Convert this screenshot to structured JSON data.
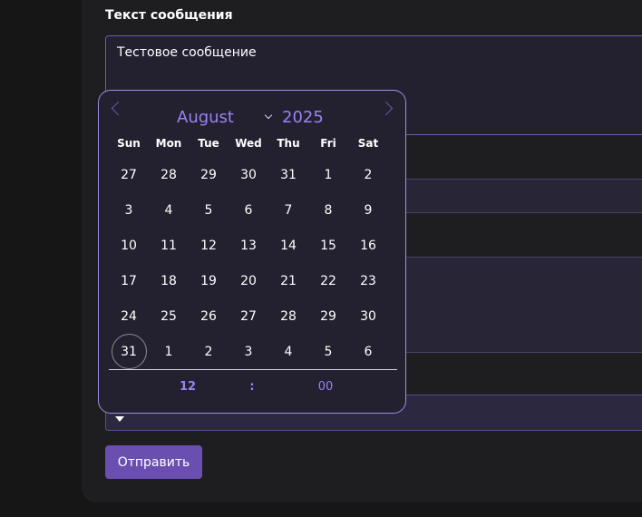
{
  "form": {
    "section_title": "Текст сообщения",
    "message_value": "Тестовое сообщение",
    "submit_label": "Отправить"
  },
  "datepicker": {
    "month": "August",
    "year": "2025",
    "weekdays": [
      "Sun",
      "Mon",
      "Tue",
      "Wed",
      "Thu",
      "Fri",
      "Sat"
    ],
    "days": [
      "27",
      "28",
      "29",
      "30",
      "31",
      "1",
      "2",
      "3",
      "4",
      "5",
      "6",
      "7",
      "8",
      "9",
      "10",
      "11",
      "12",
      "13",
      "14",
      "15",
      "16",
      "17",
      "18",
      "19",
      "20",
      "21",
      "22",
      "23",
      "24",
      "25",
      "26",
      "27",
      "28",
      "29",
      "30",
      "31",
      "1",
      "2",
      "3",
      "4",
      "5",
      "6"
    ],
    "selected_day": "31",
    "time": {
      "hour": "12",
      "separator": ":",
      "minute": "00"
    }
  },
  "colors": {
    "accent": "#9b83f2",
    "button": "#6a4fb0",
    "picker_border": "#9f8ee3"
  }
}
